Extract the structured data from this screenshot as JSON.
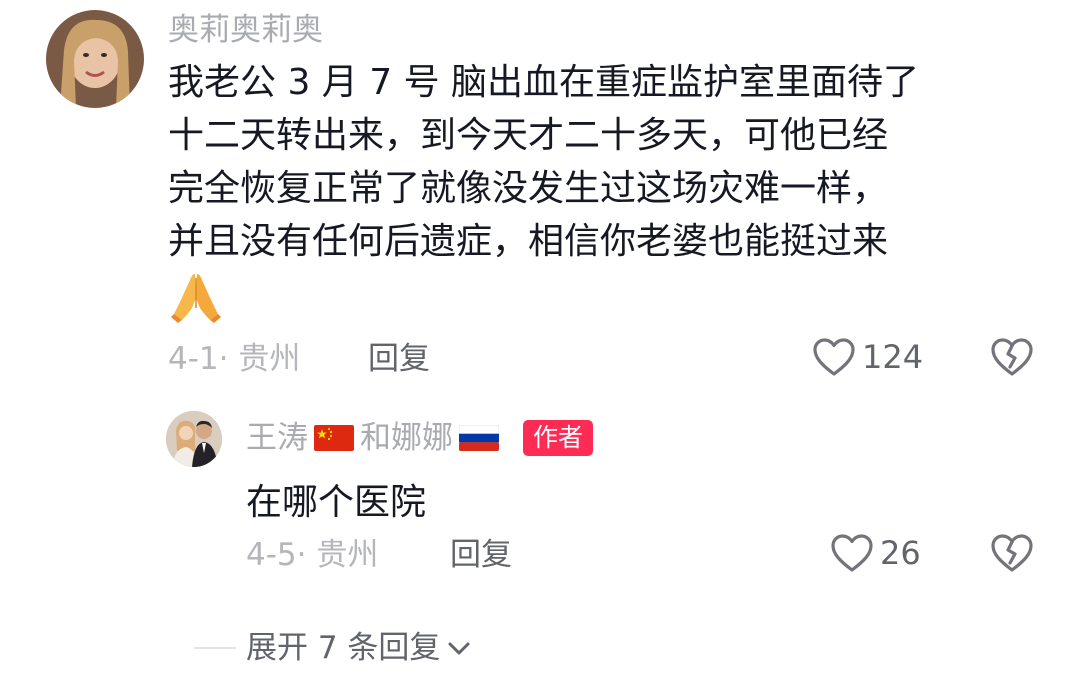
{
  "comments": [
    {
      "username": "奥莉奥莉奥",
      "text": "我老公 3 月 7 号 脑出血在重症监护室里面待了\n十二天转出来，到今天才二十多天，可他已经\n完全恢复正常了就像没发生过这场灾难一样，\n并且没有任何后遗症，相信你老婆也能挺过来",
      "emoji_icon": "folded-hands-icon",
      "date_location": "4-1· 贵州",
      "reply_label": "回复",
      "like_count": "124"
    }
  ],
  "reply": {
    "name_part1": "王涛",
    "flag1_icon": "china-flag-icon",
    "name_part2": "和娜娜",
    "flag2_icon": "russia-flag-icon",
    "author_badge": "作者",
    "text": "在哪个医院",
    "date_location": "4-5· 贵州",
    "reply_label": "回复",
    "like_count": "26"
  },
  "expand_replies": {
    "label": "展开 7 条回复",
    "icon": "chevron-down-icon"
  },
  "colors": {
    "author_badge": "#fe2c55",
    "primary_text": "#161823",
    "secondary_text": "#a9abb0"
  }
}
